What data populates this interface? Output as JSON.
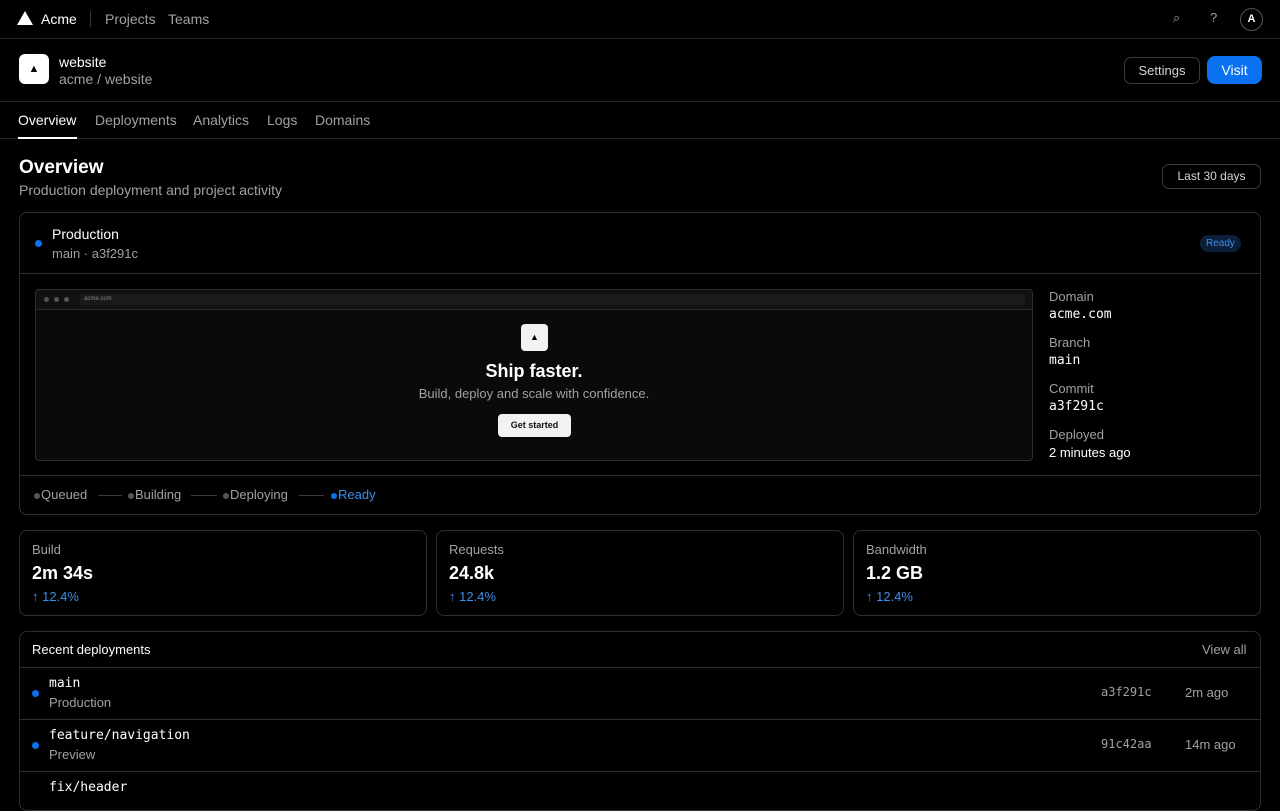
{
  "topbar": {
    "brand": "Acme",
    "links": [
      "Projects",
      "Teams"
    ],
    "search_icon": "search-icon",
    "help_icon": "help-icon",
    "help_glyph": "?",
    "avatar_initial": "A"
  },
  "project": {
    "name": "website",
    "path": "acme / website",
    "settings_label": "Settings",
    "visit_label": "Visit"
  },
  "tabs": [
    "Overview",
    "Deployments",
    "Analytics",
    "Logs",
    "Domains"
  ],
  "overview": {
    "title": "Overview",
    "subtitle": "Production deployment and project activity",
    "range": "Last 30 days"
  },
  "production": {
    "title": "Production",
    "branch_commit": "main · a3f291c",
    "status": "Ready",
    "preview": {
      "url": "acme.com",
      "headline": "Ship faster.",
      "tagline": "Build, deploy and scale with confidence.",
      "cta": "Get started"
    },
    "meta": [
      {
        "label": "Domain",
        "value": "acme.com"
      },
      {
        "label": "Branch",
        "value": "main"
      },
      {
        "label": "Commit",
        "value": "a3f291c"
      },
      {
        "label": "Deployed",
        "value": "2 minutes ago"
      }
    ],
    "steps": [
      "Queued",
      "Building",
      "Deploying",
      "Ready"
    ]
  },
  "stats": [
    {
      "label": "Build",
      "value": "2m 34s",
      "delta": "↑ 12.4%"
    },
    {
      "label": "Requests",
      "value": "24.8k",
      "delta": "↑ 12.4%"
    },
    {
      "label": "Bandwidth",
      "value": "1.2 GB",
      "delta": "↑ 12.4%"
    }
  ],
  "recent": {
    "title": "Recent deployments",
    "view_all": "View all",
    "rows": [
      {
        "branch": "main",
        "env": "Production",
        "commit": "a3f291c",
        "time": "2m ago"
      },
      {
        "branch": "feature/navigation",
        "env": "Preview",
        "commit": "91c42aa",
        "time": "14m ago"
      },
      {
        "branch": "fix/header",
        "env": "",
        "commit": "",
        "time": ""
      }
    ]
  },
  "colors": {
    "accent": "#0a72ef",
    "background": "#000000",
    "border": "#2e2e2e"
  }
}
